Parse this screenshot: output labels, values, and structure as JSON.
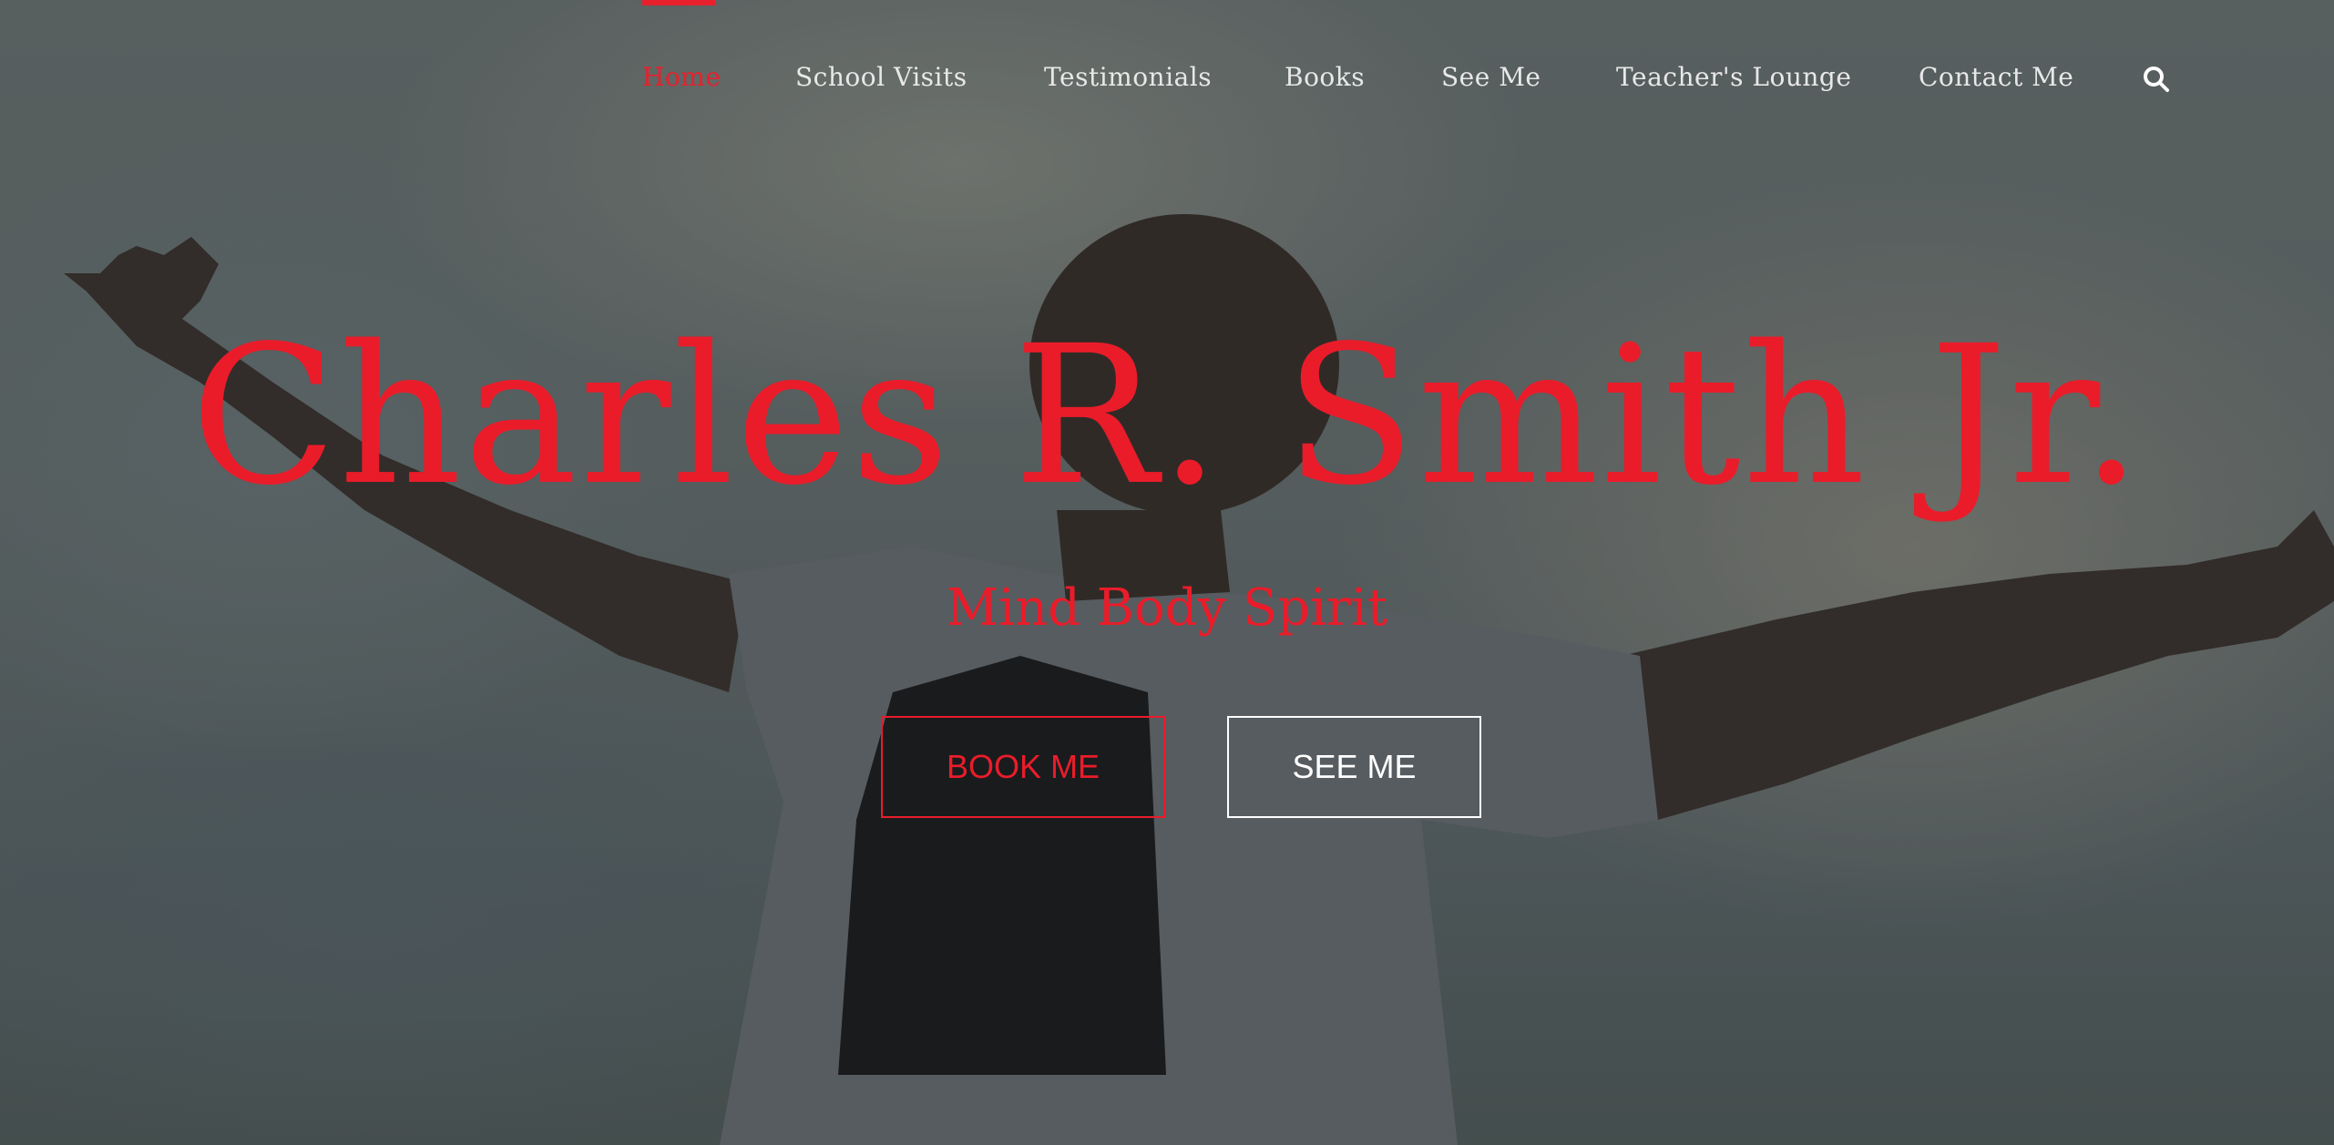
{
  "nav": {
    "items": [
      {
        "label": "Home",
        "active": true
      },
      {
        "label": "School Visits",
        "active": false
      },
      {
        "label": "Testimonials",
        "active": false
      },
      {
        "label": "Books",
        "active": false
      },
      {
        "label": "See Me",
        "active": false
      },
      {
        "label": "Teacher's Lounge",
        "active": false
      },
      {
        "label": "Contact Me",
        "active": false
      }
    ],
    "search_icon": "search-icon"
  },
  "hero": {
    "title": "Charles R. Smith Jr.",
    "subtitle": "Mind Body Spirit",
    "buttons": {
      "book_label": "BOOK ME",
      "see_label": "SEE ME"
    }
  },
  "colors": {
    "accent": "#ea1c2a",
    "nav_text": "#e8e8e8",
    "button_secondary": "#ffffff"
  }
}
